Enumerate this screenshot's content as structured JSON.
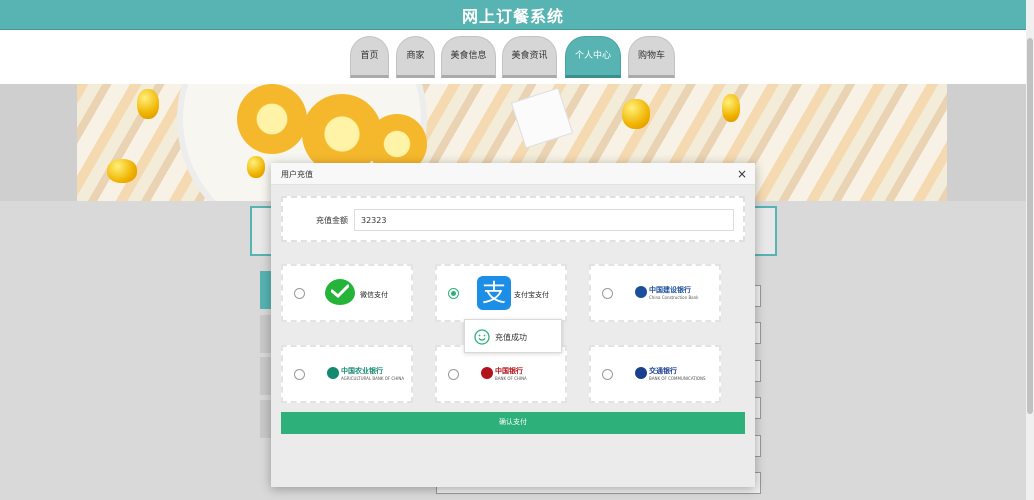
{
  "header": {
    "title": "网上订餐系统"
  },
  "nav": {
    "tabs": [
      {
        "label": "首页",
        "active": false
      },
      {
        "label": "商家",
        "active": false
      },
      {
        "label": "美食信息",
        "active": false
      },
      {
        "label": "美食资讯",
        "active": false
      },
      {
        "label": "个人中心",
        "active": true
      },
      {
        "label": "购物车",
        "active": false
      }
    ]
  },
  "modal": {
    "title": "用户充值",
    "close": "×",
    "amount_label": "充值金额",
    "amount_value": "32323",
    "payment_methods": [
      {
        "label": "微信支付",
        "icon": "wechat-pay-icon",
        "selected": false
      },
      {
        "label": "支付宝支付",
        "icon": "alipay-icon",
        "selected": true
      },
      {
        "label": "中国建设银行",
        "sub": "China Construction Bank",
        "icon": "ccb-logo",
        "selected": false
      },
      {
        "label": "中国农业银行",
        "sub": "AGRICULTURAL BANK OF CHINA",
        "icon": "abc-logo",
        "selected": false
      },
      {
        "label": "中国银行",
        "sub": "BANK OF CHINA",
        "icon": "boc-logo",
        "selected": false
      },
      {
        "label": "交通银行",
        "sub": "BANK OF COMMUNICATIONS",
        "icon": "bocom-logo",
        "selected": false
      }
    ],
    "toast": "充值成功",
    "confirm": "确认支付"
  },
  "colors": {
    "teal": "#58b3b3",
    "green": "#2db07a",
    "wechat": "#24b43a",
    "alipay": "#1d8ee6",
    "ccb": "#1b4f9c",
    "abc": "#138a6f",
    "boc": "#b3121b",
    "bocom": "#1a3f8f"
  }
}
